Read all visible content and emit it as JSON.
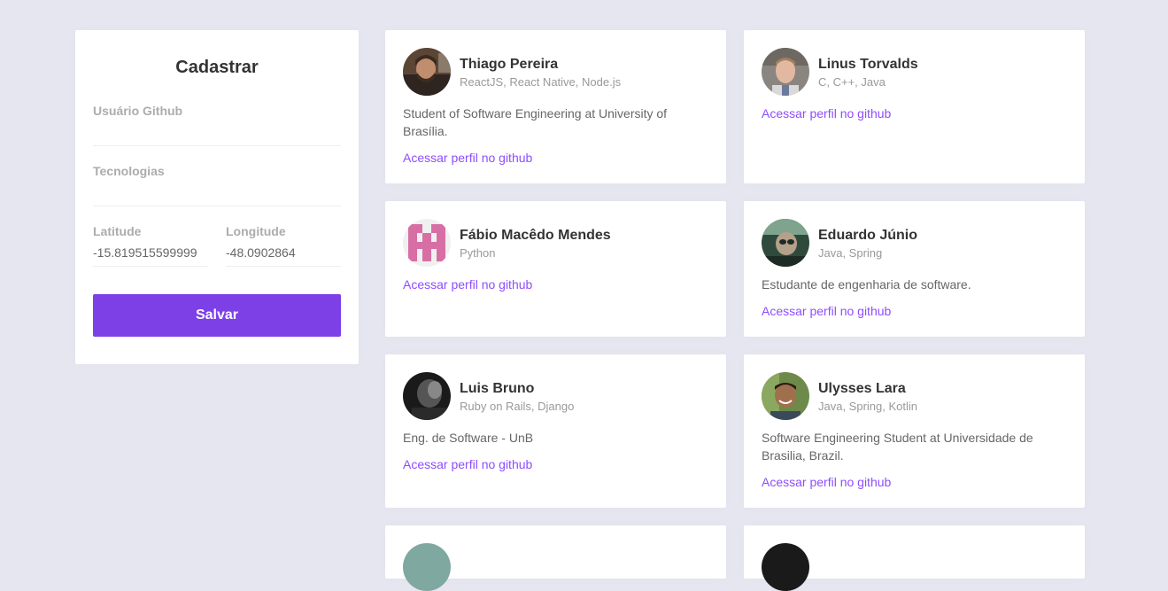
{
  "form": {
    "title": "Cadastrar",
    "github_label": "Usuário Github",
    "github_value": "",
    "techs_label": "Tecnologias",
    "techs_value": "",
    "latitude_label": "Latitude",
    "latitude_value": "-15.819515599999",
    "longitude_label": "Longitude",
    "longitude_value": "-48.0902864",
    "save_label": "Salvar"
  },
  "colors": {
    "background": "#e6e6f0",
    "accent": "#7d40e7",
    "link": "#8e4dff"
  },
  "devs": [
    {
      "name": "Thiago Pereira",
      "techs": "ReactJS, React Native, Node.js",
      "bio": "Student of Software Engineering at University of Brasília.",
      "link": "Acessar perfil no github",
      "avatar": "photo"
    },
    {
      "name": "Linus Torvalds",
      "techs": "C, C++, Java",
      "bio": "",
      "link": "Acessar perfil no github",
      "avatar": "photo"
    },
    {
      "name": "Fábio Macêdo Mendes",
      "techs": "Python",
      "bio": "",
      "link": "Acessar perfil no github",
      "avatar": "identicon"
    },
    {
      "name": "Eduardo Júnio",
      "techs": "Java, Spring",
      "bio": "Estudante de engenharia de software.",
      "link": "Acessar perfil no github",
      "avatar": "photo"
    },
    {
      "name": "Luis Bruno",
      "techs": "Ruby on Rails, Django",
      "bio": "Eng. de Software - UnB",
      "link": "Acessar perfil no github",
      "avatar": "photo"
    },
    {
      "name": "Ulysses Lara",
      "techs": "Java, Spring, Kotlin",
      "bio": "Software Engineering Student at Universidade de Brasilia, Brazil.",
      "link": "Acessar perfil no github",
      "avatar": "photo"
    }
  ]
}
